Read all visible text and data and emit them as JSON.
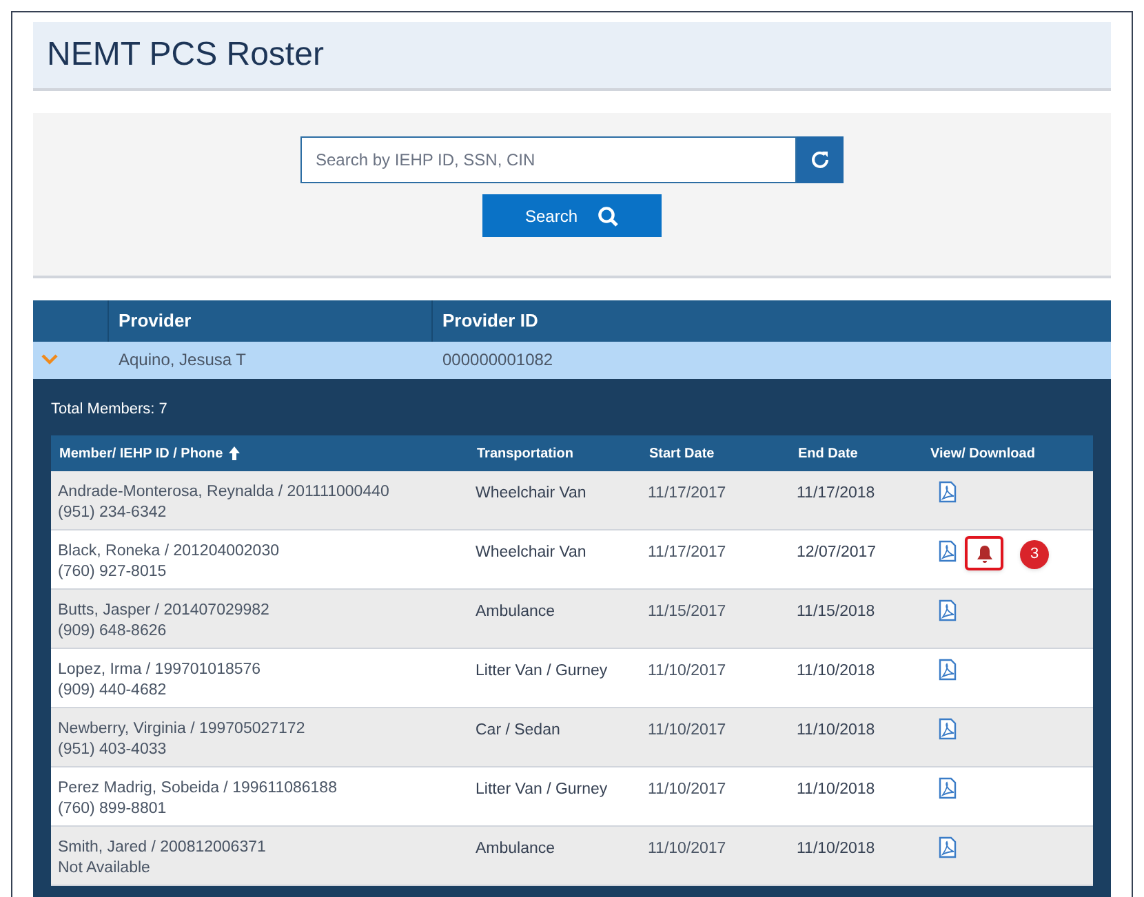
{
  "title": "NEMT PCS Roster",
  "search": {
    "placeholder": "Search by IEHP ID, SSN, CIN",
    "button": "Search"
  },
  "providers_table": {
    "columns": [
      "Provider",
      "Provider ID"
    ],
    "rows": [
      {
        "expanded": true,
        "provider": "Aquino, Jesusa T",
        "provider_id": "000000001082"
      }
    ]
  },
  "total_members": "Total Members: 7",
  "members_table": {
    "columns": [
      "Member/ IEHP ID / Phone",
      "Transportation",
      "Start Date",
      "End Date",
      "View/ Download"
    ],
    "rows": [
      {
        "member": "Andrade-Monterosa, Reynalda / 201111000440",
        "phone": "(951) 234-6342",
        "transportation": "Wheelchair Van",
        "start_date": "11/17/2017",
        "end_date": "11/17/2018",
        "alert": false
      },
      {
        "member": "Black, Roneka / 201204002030",
        "phone": "(760) 927-8015",
        "transportation": "Wheelchair Van",
        "start_date": "11/17/2017",
        "end_date": "12/07/2017",
        "alert": true,
        "alert_count": "3"
      },
      {
        "member": "Butts, Jasper / 201407029982",
        "phone": "(909) 648-8626",
        "transportation": "Ambulance",
        "start_date": "11/15/2017",
        "end_date": "11/15/2018",
        "alert": false
      },
      {
        "member": "Lopez, Irma / 199701018576",
        "phone": "(909) 440-4682",
        "transportation": "Litter Van / Gurney",
        "start_date": "11/10/2017",
        "end_date": "11/10/2018",
        "alert": false
      },
      {
        "member": "Newberry, Virginia / 199705027172",
        "phone": "(951) 403-4033",
        "transportation": "Car / Sedan",
        "start_date": "11/10/2017",
        "end_date": "11/10/2018",
        "alert": false
      },
      {
        "member": "Perez Madrig, Sobeida / 199611086188",
        "phone": "(760) 899-8801",
        "transportation": "Litter Van / Gurney",
        "start_date": "11/10/2017",
        "end_date": "11/10/2018",
        "alert": false
      },
      {
        "member": "Smith, Jared / 200812006371",
        "phone": "Not Available",
        "transportation": "Ambulance",
        "start_date": "11/10/2017",
        "end_date": "11/10/2018",
        "alert": false
      }
    ]
  }
}
